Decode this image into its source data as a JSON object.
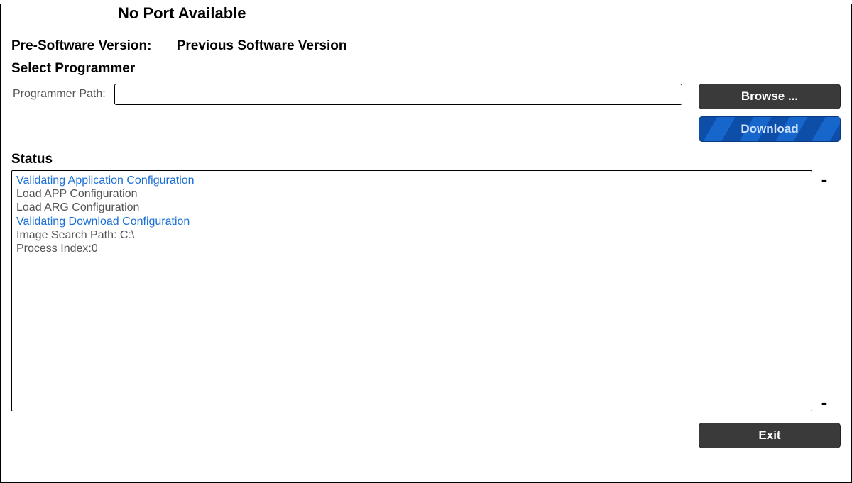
{
  "header": {
    "title": "No Port Available"
  },
  "version": {
    "label": "Pre-Software Version:",
    "value": "Previous Software Version"
  },
  "programmer": {
    "section_label": "Select Programmer",
    "path_label": "Programmer Path:",
    "path_value": "",
    "browse_label": "Browse ...",
    "download_label": "Download"
  },
  "status": {
    "heading": "Status",
    "lines": [
      {
        "text": "Validating Application Configuration",
        "highlight": true
      },
      {
        "text": "Load APP Configuration",
        "highlight": false
      },
      {
        "text": "Load ARG Configuration",
        "highlight": false
      },
      {
        "text": "Validating Download Configuration",
        "highlight": true
      },
      {
        "text": "Image Search Path: C:\\",
        "highlight": false
      },
      {
        "text": "Process Index:0",
        "highlight": false
      }
    ],
    "up_marker": "-",
    "down_marker": "-"
  },
  "footer": {
    "exit_label": "Exit"
  }
}
